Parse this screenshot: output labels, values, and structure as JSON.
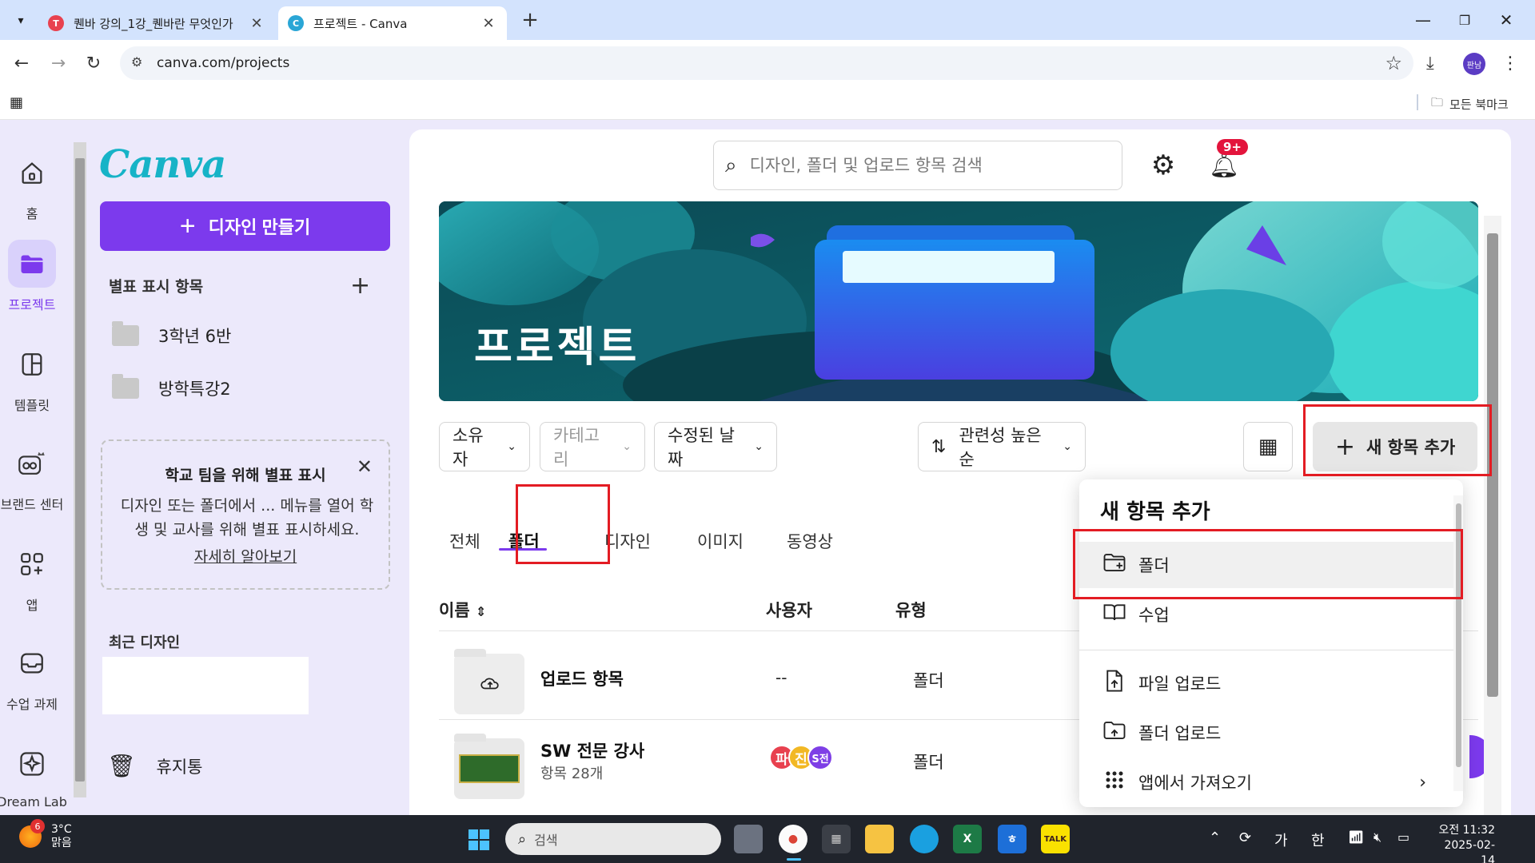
{
  "browser": {
    "tabs": [
      {
        "title": "퀜바 강의_1강_퀜바란 무엇인가",
        "active": false
      },
      {
        "title": "프로젝트 - Canva",
        "active": true
      }
    ],
    "url": "canva.com/projects",
    "profile_initial": "판남",
    "bookmarks_all": "모든 북마크"
  },
  "rail": {
    "items": [
      {
        "label": "홈",
        "icon": "home-icon"
      },
      {
        "label": "프로젝트",
        "icon": "folder-icon"
      },
      {
        "label": "템플릿",
        "icon": "template-icon"
      },
      {
        "label": "브랜드 센터",
        "icon": "brand-icon"
      },
      {
        "label": "앱",
        "icon": "apps-icon"
      },
      {
        "label": "수업 과제",
        "icon": "inbox-icon"
      },
      {
        "label": "Dream Lab",
        "icon": "dream-lab-icon"
      }
    ]
  },
  "sidebar": {
    "logo": "Canva",
    "create_label": "디자인 만들기",
    "starred_title": "별표 표시 항목",
    "folders": [
      "3학년 6반",
      "방학특강2"
    ],
    "promo": {
      "title": "학교 팀을 위해 별표 표시",
      "desc": "디자인 또는 폴더에서 ... 메뉴를 열어 학생 및 교사를 위해 별표 표시하세요.",
      "link": "자세히 알아보기"
    },
    "recent_title": "최근 디자인",
    "trash_label": "휴지통"
  },
  "main": {
    "search_placeholder": "디자인, 폴더 및 업로드 항목 검색",
    "notification_badge": "9+",
    "hero_title": "프로젝트",
    "filters": [
      "소유자",
      "카테고리",
      "수정된 날짜"
    ],
    "sort_label": "관련성 높은 순",
    "new_item_label": "새 항목 추가",
    "tabs": [
      "전체",
      "폴더",
      "디자인",
      "이미지",
      "동영상"
    ],
    "active_tab": "폴더",
    "columns": {
      "name": "이름",
      "user": "사용자",
      "type": "유형"
    },
    "rows": [
      {
        "name": "업로드 항목",
        "sub": "",
        "user": "--",
        "type": "폴더"
      },
      {
        "name": "SW 전문 강사",
        "sub": "항목 28개",
        "user": "",
        "type": "폴더",
        "avatars": [
          {
            "letter": "파",
            "color": "#e8414f"
          },
          {
            "letter": "진",
            "color": "#f2b824"
          },
          {
            "letter": "S전",
            "color": "#7e3fe6"
          }
        ]
      }
    ]
  },
  "dropdown": {
    "title": "새 항목 추가",
    "items": [
      {
        "label": "폴더",
        "icon": "folder-plus-icon"
      },
      {
        "label": "수업",
        "icon": "book-icon"
      },
      {
        "label": "파일 업로드",
        "icon": "file-upload-icon"
      },
      {
        "label": "폴더 업로드",
        "icon": "folder-upload-icon"
      },
      {
        "label": "앱에서 가져오기",
        "icon": "grid-dots-icon"
      }
    ]
  },
  "taskbar": {
    "weather_temp": "3°C",
    "weather_desc": "맑음",
    "weather_badge": "6",
    "search_label": "검색",
    "ime_1": "가",
    "ime_2": "한",
    "time": "오전 11:32",
    "date": "2025-02-14"
  }
}
